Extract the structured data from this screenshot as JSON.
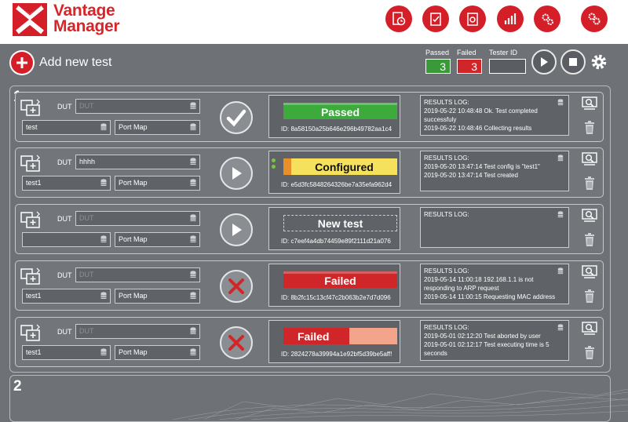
{
  "app": {
    "brand_line1": "Vantage",
    "brand_line2": "Manager",
    "accent_color": "#d41f29"
  },
  "header_buttons": [
    "report-clock-icon",
    "checklist-icon",
    "settings-list-icon",
    "bar-chart-icon",
    "gears-icon",
    "users-settings-icon"
  ],
  "toolbar": {
    "add_label": "Add new test",
    "passed_label": "Passed",
    "passed_count": "3",
    "failed_label": "Failed",
    "failed_count": "3",
    "tester_id_label": "Tester ID",
    "tester_id_value": ""
  },
  "groups": [
    {
      "number": "1"
    },
    {
      "number": "2"
    }
  ],
  "tests": [
    {
      "dut_label": "DUT",
      "dut_value": "",
      "dut_placeholder": "DUT",
      "config": "test",
      "port_map": "Port Map",
      "run_icon": "checkmark-icon",
      "status": "Passed",
      "status_color": "#3cab3c",
      "progress": 1.0,
      "id": "ID:  8a58150a25b646e296b49782aa1c4",
      "log_title": "RESULTS LOG:",
      "log_lines": [
        "2019-05-22 10:48:48 Ok. Test completed successfuly",
        "2019-05-22 10:48:46 Collecting results"
      ]
    },
    {
      "dut_label": "DUT",
      "dut_value": "hhhh",
      "dut_placeholder": "DUT",
      "config": "test1",
      "port_map": "Port Map",
      "run_icon": "play-icon",
      "status": "Configured",
      "status_color": "#f6e15c",
      "progress": 0.1,
      "id": "ID:  e5d3fc5848264326be7a35efa962d4",
      "log_title": "RESULTS LOG:",
      "log_lines": [
        "2019-05-20 13:47:14 Test config is \"test1\"",
        "2019-05-20 13:47:14 Test created"
      ]
    },
    {
      "dut_label": "DUT",
      "dut_value": "",
      "dut_placeholder": "DUT",
      "config": "",
      "port_map": "Port Map",
      "run_icon": "play-icon",
      "status": "New test",
      "status_color": "#5f6367",
      "progress": 0,
      "id": "ID:  c7eef4a4db74459e89f2111d21a076",
      "log_title": "RESULTS LOG:",
      "log_lines": []
    },
    {
      "dut_label": "DUT",
      "dut_value": "",
      "dut_placeholder": "DUT",
      "config": "test1",
      "port_map": "Port Map",
      "run_icon": "x-mark-icon",
      "status": "Failed",
      "status_color": "#d0262a",
      "progress": 1.0,
      "id": "ID:  8b2fc15c13cf47c2b063b2e7d7d096",
      "log_title": "RESULTS LOG:",
      "log_lines": [
        "2019-05-14 11:00:18 192.168.1.1 is not responding to ARP request",
        "2019-05-14 11:00:15 Requesting MAC address"
      ]
    },
    {
      "dut_label": "DUT",
      "dut_value": "",
      "dut_placeholder": "DUT",
      "config": "test1",
      "port_map": "Port Map",
      "run_icon": "x-mark-icon",
      "status": "Failed",
      "status_color": "#d0262a",
      "progress": 0.58,
      "id": "ID:  2824278a39994a1e92bf5d39be5aff!",
      "log_title": "RESULTS LOG:",
      "log_lines": [
        "2019-05-01 02:12:20 Test aborted by user",
        "2019-05-01 02:12:17 Test executing time is 5 seconds"
      ]
    }
  ]
}
